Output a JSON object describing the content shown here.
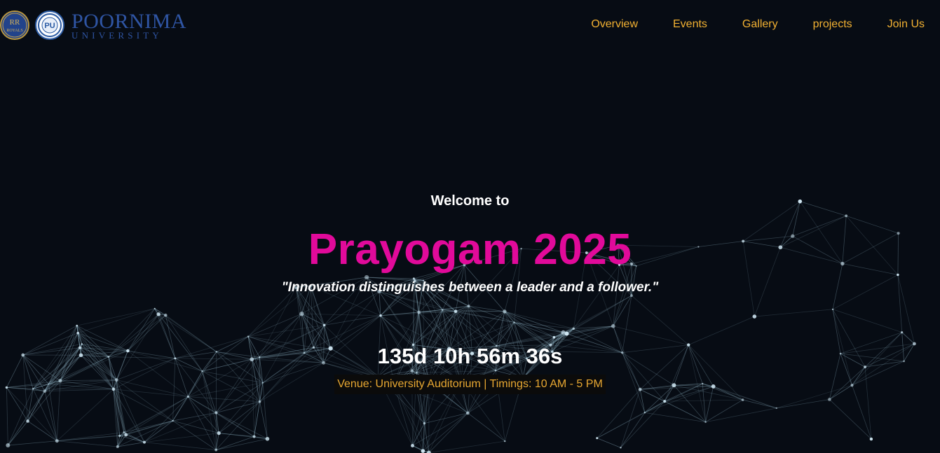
{
  "header": {
    "logos": {
      "rr_logo_text": "ROYALS",
      "pu_logo_text": "PU",
      "university_name": "POORNIMA",
      "university_sub": "UNIVERSITY"
    },
    "nav": [
      {
        "label": "Overview"
      },
      {
        "label": "Events"
      },
      {
        "label": "Gallery"
      },
      {
        "label": "projects"
      },
      {
        "label": "Join Us"
      }
    ]
  },
  "hero": {
    "welcome": "Welcome to",
    "title": "Prayogam 2025",
    "quote": "\"Innovation distinguishes between a leader and a follower.\"",
    "countdown": "135d 10h 56m 36s",
    "venue": "Venue: University Auditorium | Timings: 10 AM - 5 PM"
  },
  "colors": {
    "background": "#070c14",
    "nav_text": "#f2b132",
    "title": "#e10a9a",
    "venue_text": "#e8a832",
    "network_lines": "#8fb3c4"
  }
}
